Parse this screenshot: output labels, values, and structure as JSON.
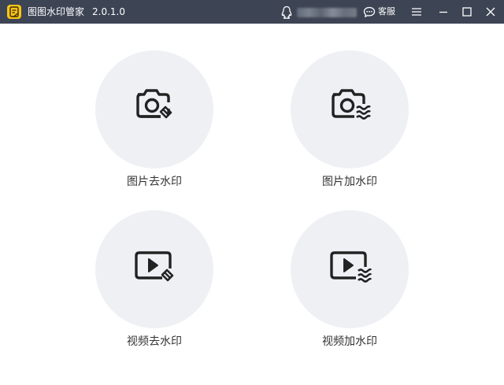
{
  "titlebar": {
    "app_name": "图图水印管家",
    "version": "2.0.1.0",
    "service_label": "客服",
    "bg_color": "#3d4454",
    "logo_color": "#f5c518"
  },
  "icons": {
    "qq": "qq-penguin-icon",
    "service": "chat-bubble-icon",
    "menu": "hamburger-menu-icon",
    "minimize": "minimize-icon",
    "maximize": "maximize-icon",
    "close": "close-icon"
  },
  "tools": [
    {
      "label": "图片去水印",
      "icon": "camera-eraser-icon"
    },
    {
      "label": "图片加水印",
      "icon": "camera-wave-icon"
    },
    {
      "label": "视频去水印",
      "icon": "video-eraser-icon"
    },
    {
      "label": "视频加水印",
      "icon": "video-wave-icon"
    }
  ],
  "colors": {
    "circle_bg": "#eef0f4",
    "icon_stroke": "#222222",
    "label_text": "#333333"
  }
}
